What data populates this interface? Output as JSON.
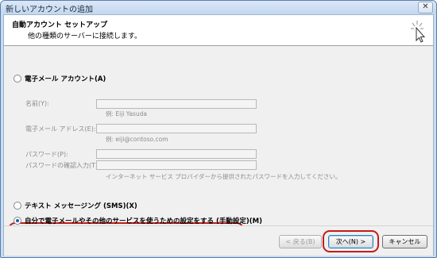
{
  "window": {
    "title": "新しいアカウントの追加",
    "close_glyph": "✕"
  },
  "header": {
    "title": "自動アカウント セットアップ",
    "subtitle": "他の種類のサーバーに接続します。"
  },
  "options": {
    "email_account_label": "電子メール アカウント(A)",
    "sms_label": "テキスト メッセージング (SMS)(X)",
    "manual_label": "自分で電子メールやその他のサービスを使うための設定をする (手動設定)(M)",
    "selected": "manual"
  },
  "fields": {
    "name_label": "名前(Y):",
    "name_example": "例: Eiji Yasuda",
    "email_label": "電子メール アドレス(E):",
    "email_example": "例: eiji@contoso.com",
    "password_label": "パスワード(P):",
    "password_confirm_label": "パスワードの確認入力(T):",
    "password_hint": "インターネット サービス プロバイダーから提供されたパスワードを入力してください。"
  },
  "footer": {
    "back_label": "< 戻る(B)",
    "next_label": "次へ(N) >",
    "cancel_label": "キャンセル"
  },
  "colors": {
    "highlight": "#c51b1b",
    "accent": "#3c7fb1"
  }
}
